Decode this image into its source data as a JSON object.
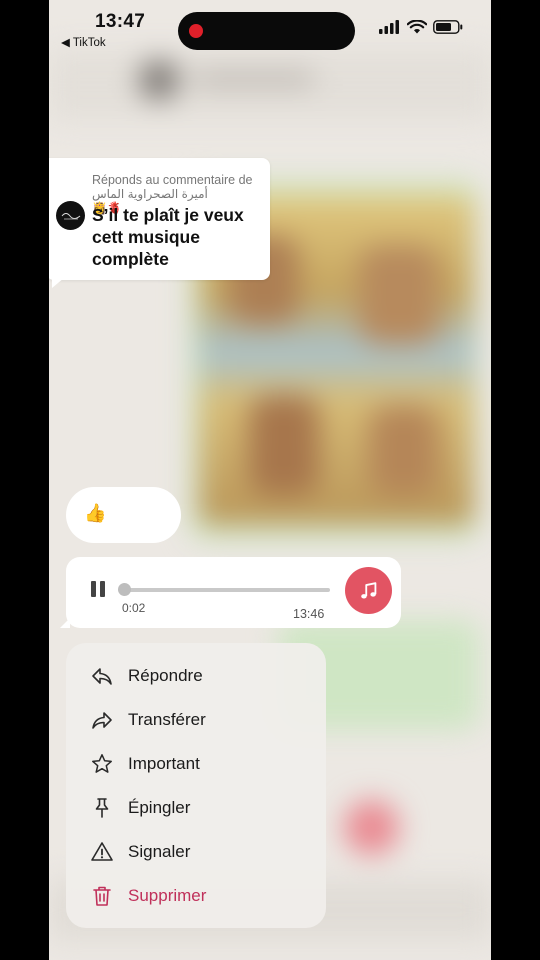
{
  "status_bar": {
    "time": "13:47",
    "back_app": "◀ TikTok",
    "recording_color": "#e0202a",
    "icons": [
      "signal-icon",
      "wifi-icon",
      "battery-icon"
    ]
  },
  "comment": {
    "reply_label": "Réponds au commentaire de",
    "author": "أميرة الصحراوية الماس 🫀👸",
    "text": "S’il te plaît je veux cett musique complète"
  },
  "emoji_message": {
    "emoji": "👍"
  },
  "audio_message": {
    "elapsed": "0:02",
    "duration": "13:46",
    "progress": 0.0,
    "accent_color": "#e25463"
  },
  "context_menu": {
    "items": [
      {
        "label": "Répondre",
        "icon": "reply-icon"
      },
      {
        "label": "Transférer",
        "icon": "forward-icon"
      },
      {
        "label": "Important",
        "icon": "star-icon"
      },
      {
        "label": "Épingler",
        "icon": "pin-icon"
      },
      {
        "label": "Signaler",
        "icon": "warning-icon"
      },
      {
        "label": "Supprimer",
        "icon": "trash-icon",
        "color": "#c0305a"
      }
    ]
  }
}
